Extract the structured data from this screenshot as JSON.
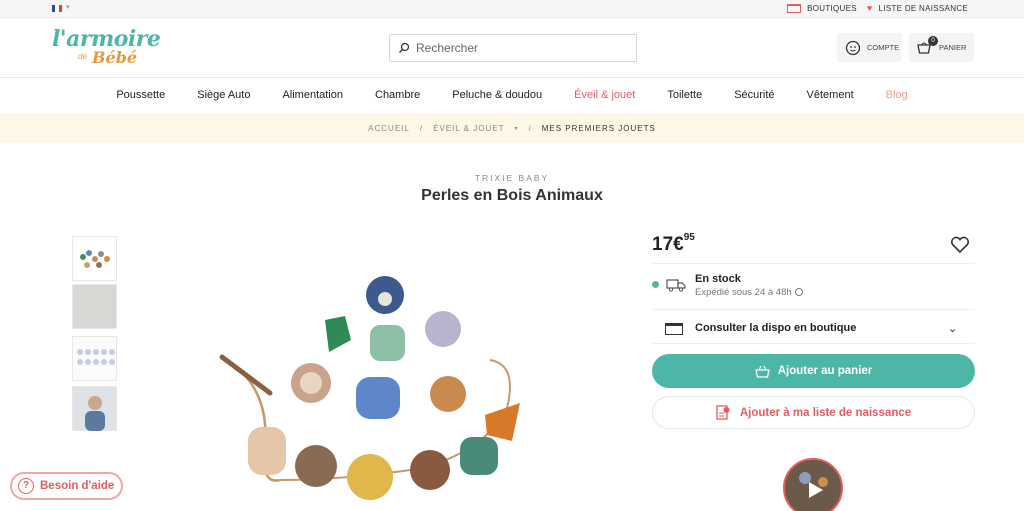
{
  "colors": {
    "accent_teal": "#4db7a7",
    "accent_red": "#e35d5d",
    "breadcrumb_bg": "#fdf7e7"
  },
  "topbar": {
    "shops": "BOUTIQUES",
    "birth_list": "LISTE DE NAISSANCE"
  },
  "logo": {
    "line1": "l'armoire",
    "line2": "de",
    "line3": "Bébé"
  },
  "search": {
    "placeholder": "Rechercher"
  },
  "account": {
    "label": "COMPTE"
  },
  "cart": {
    "label": "PANIER",
    "count": "0"
  },
  "nav": {
    "items": [
      "Poussette",
      "Siège Auto",
      "Alimentation",
      "Chambre",
      "Peluche & doudou",
      "Éveil & jouet",
      "Toilette",
      "Sécurité",
      "Vêtement",
      "Blog"
    ]
  },
  "breadcrumb": {
    "items": [
      "ACCUEIL",
      "ÉVEIL & JOUET",
      "MES PREMIERS JOUETS"
    ]
  },
  "product": {
    "brand": "TRIXIE BABY",
    "title": "Perles en Bois Animaux",
    "price_main": "17€",
    "price_cents": "95",
    "stock": "En stock",
    "shipping": "Expédié sous 24 à 48h",
    "store_check": "Consulter la dispo en boutique",
    "add_to_cart": "Ajouter au panier",
    "add_to_list": "Ajouter à ma liste de naissance"
  },
  "help": {
    "label": "Besoin d'aide"
  },
  "icons": [
    "search-icon",
    "account-icon",
    "cart-icon",
    "heart-icon",
    "truck-icon",
    "clock-icon",
    "store-icon",
    "chevron-down-icon",
    "basket-icon",
    "gift-list-icon",
    "help-icon",
    "play-icon"
  ]
}
